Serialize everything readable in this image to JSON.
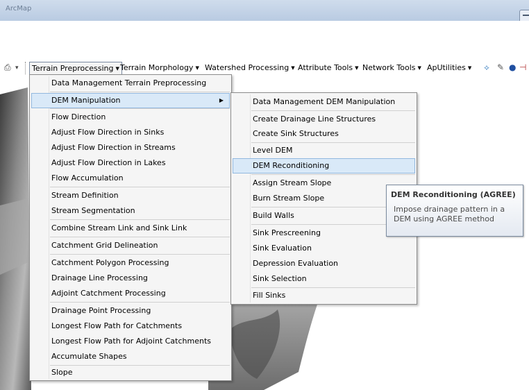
{
  "window": {
    "title": "ArcMap"
  },
  "toolbar": {
    "menus": [
      {
        "label": "Terrain Preprocessing"
      },
      {
        "label": "Terrain Morphology"
      },
      {
        "label": "Watershed Processing"
      },
      {
        "label": "Attribute Tools"
      },
      {
        "label": "Network Tools"
      },
      {
        "label": "ApUtilities"
      }
    ]
  },
  "main_menu": {
    "items": [
      "Data Management Terrain Preprocessing",
      "DEM Manipulation",
      "Flow Direction",
      "Adjust Flow Direction in Sinks",
      "Adjust Flow Direction in Streams",
      "Adjust Flow Direction in Lakes",
      "Flow Accumulation",
      "Stream Definition",
      "Stream Segmentation",
      "Combine Stream Link and Sink Link",
      "Catchment Grid Delineation",
      "Catchment Polygon Processing",
      "Drainage Line Processing",
      "Adjoint Catchment Processing",
      "Drainage Point Processing",
      "Longest Flow Path for Catchments",
      "Longest Flow Path for Adjoint Catchments",
      "Accumulate Shapes",
      "Slope"
    ]
  },
  "sub_menu": {
    "items": [
      "Data Management DEM Manipulation",
      "Create Drainage Line Structures",
      "Create Sink Structures",
      "Level DEM",
      "DEM Reconditioning",
      "Assign Stream Slope",
      "Burn Stream Slope",
      "Build Walls",
      "Sink Prescreening",
      "Sink Evaluation",
      "Depression Evaluation",
      "Sink Selection",
      "Fill Sinks"
    ]
  },
  "tooltip": {
    "title": "DEM Reconditioning (AGREE)",
    "body": "Impose drainage pattern in a DEM using AGREE method"
  }
}
